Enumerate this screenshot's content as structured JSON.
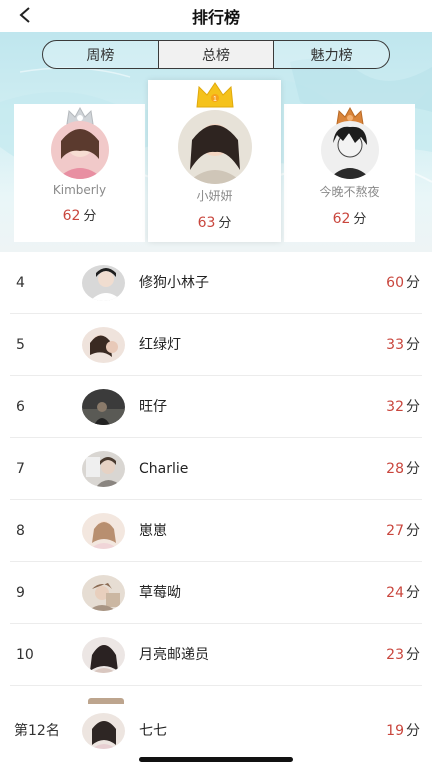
{
  "nav": {
    "title": "排行榜",
    "back_icon": "chevron-left-icon"
  },
  "tabs": [
    {
      "label": "周榜",
      "active": false
    },
    {
      "label": "总榜",
      "active": true
    },
    {
      "label": "魅力榜",
      "active": false
    }
  ],
  "podium": {
    "first": {
      "name": "小妍妍",
      "score": "63",
      "unit": "分",
      "crown_icon": "gold-crown-icon"
    },
    "second": {
      "name": "Kimberly",
      "score": "62",
      "unit": "分",
      "crown_icon": "silver-crown-icon"
    },
    "third": {
      "name": "今晚不熬夜",
      "score": "62",
      "unit": "分",
      "crown_icon": "bronze-crown-icon"
    }
  },
  "ranking": [
    {
      "rank": "4",
      "name": "修狗小林子",
      "score": "60",
      "unit": "分"
    },
    {
      "rank": "5",
      "name": "红绿灯",
      "score": "33",
      "unit": "分"
    },
    {
      "rank": "6",
      "name": "旺仔",
      "score": "32",
      "unit": "分"
    },
    {
      "rank": "7",
      "name": "Charlie",
      "score": "28",
      "unit": "分"
    },
    {
      "rank": "8",
      "name": "崽崽",
      "score": "27",
      "unit": "分"
    },
    {
      "rank": "9",
      "name": "草莓呦",
      "score": "24",
      "unit": "分"
    },
    {
      "rank": "10",
      "name": "月亮邮递员",
      "score": "23",
      "unit": "分"
    }
  ],
  "my_rank": {
    "rank": "第12名",
    "name": "七七",
    "score": "19",
    "unit": "分"
  },
  "colors": {
    "score": "#c9463d",
    "hero_bg": "#cdeef3",
    "gold": "#f5c21b",
    "silver": "#d0d4d8",
    "bronze": "#d9843a"
  }
}
